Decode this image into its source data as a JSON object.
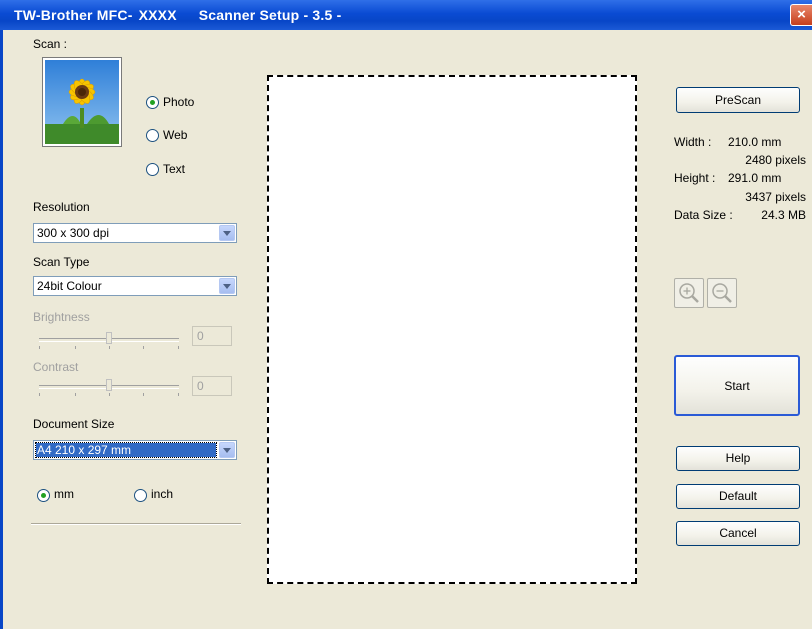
{
  "window": {
    "title_part1": "TW-Brother MFC-",
    "title_part2": "XXXX",
    "title_part3": "Scanner Setup - 3.5 -",
    "close_glyph": "×"
  },
  "scan": {
    "label": "Scan :",
    "options": [
      {
        "label": "Photo",
        "selected": true
      },
      {
        "label": "Web",
        "selected": false
      },
      {
        "label": "Text",
        "selected": false
      }
    ]
  },
  "resolution": {
    "label": "Resolution",
    "value": "300 x 300 dpi"
  },
  "scan_type": {
    "label": "Scan Type",
    "value": "24bit Colour"
  },
  "brightness": {
    "label": "Brightness",
    "value": "0"
  },
  "contrast": {
    "label": "Contrast",
    "value": "0"
  },
  "document_size": {
    "label": "Document Size",
    "value": "A4 210 x 297 mm"
  },
  "units": [
    {
      "label": "mm",
      "selected": true
    },
    {
      "label": "inch",
      "selected": false
    }
  ],
  "prescan_label": "PreScan",
  "info": {
    "width_label": "Width :",
    "width_mm": "210.0 mm",
    "width_px": "2480 pixels",
    "height_label": "Height :",
    "height_mm": "291.0 mm",
    "height_px": "3437 pixels",
    "datasize_label": "Data Size :",
    "datasize_value": "24.3 MB"
  },
  "buttons": {
    "start": "Start",
    "help": "Help",
    "default": "Default",
    "cancel": "Cancel"
  }
}
